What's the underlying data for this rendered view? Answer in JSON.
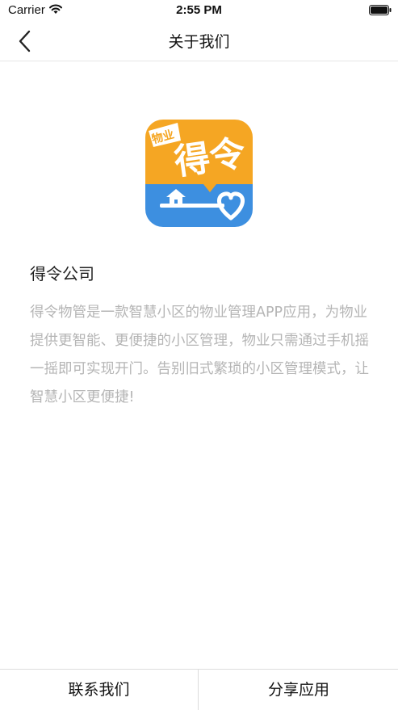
{
  "status_bar": {
    "carrier": "Carrier",
    "time": "2:55 PM"
  },
  "nav": {
    "title": "关于我们",
    "back_icon": "chevron-left-icon"
  },
  "logo": {
    "tag": "物业",
    "main": "得令",
    "colors": {
      "top": "#f5a623",
      "bottom": "#3d8fe0"
    }
  },
  "company": {
    "name": "得令公司",
    "description": "得令物管是一款智慧小区的物业管理APP应用，为物业提供更智能、更便捷的小区管理，物业只需通过手机摇一摇即可实现开门。告别旧式繁琐的小区管理模式，让智慧小区更便捷!"
  },
  "bottom_bar": {
    "contact_label": "联系我们",
    "share_label": "分享应用"
  }
}
